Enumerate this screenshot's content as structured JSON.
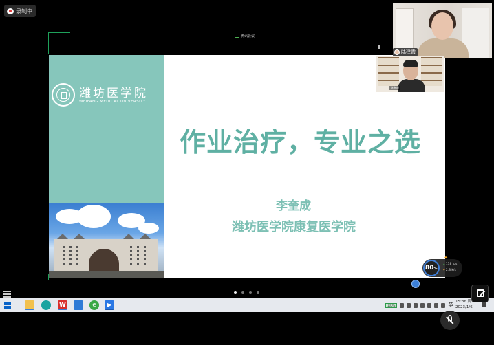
{
  "recording": {
    "label": "录制中"
  },
  "meeting": {
    "label": "腾讯会议"
  },
  "slide": {
    "university_cn": "潍坊医学院",
    "university_en": "WEIFANG MEDICAL UNIVERSITY",
    "title": "作业治疗，专业之选",
    "author": "李奎成",
    "department": "潍坊医学院康复医学院",
    "panel_color": "#86c6bb",
    "title_color": "#5fb0a3"
  },
  "pagination": {
    "dots": 4,
    "active": 1
  },
  "participants": {
    "active_speaker": "陆建霞",
    "self_name": "李奎成"
  },
  "network": {
    "score": "80",
    "score_unit": "%",
    "upload": "118 k/s",
    "download": "2.8 k/s"
  },
  "taskbar": {
    "wps_label": "W",
    "ie_label": "e",
    "meeting_label": "▶",
    "battery": "100%",
    "ime": "英",
    "time": "15:36 周五",
    "date": "2023/1/6"
  }
}
